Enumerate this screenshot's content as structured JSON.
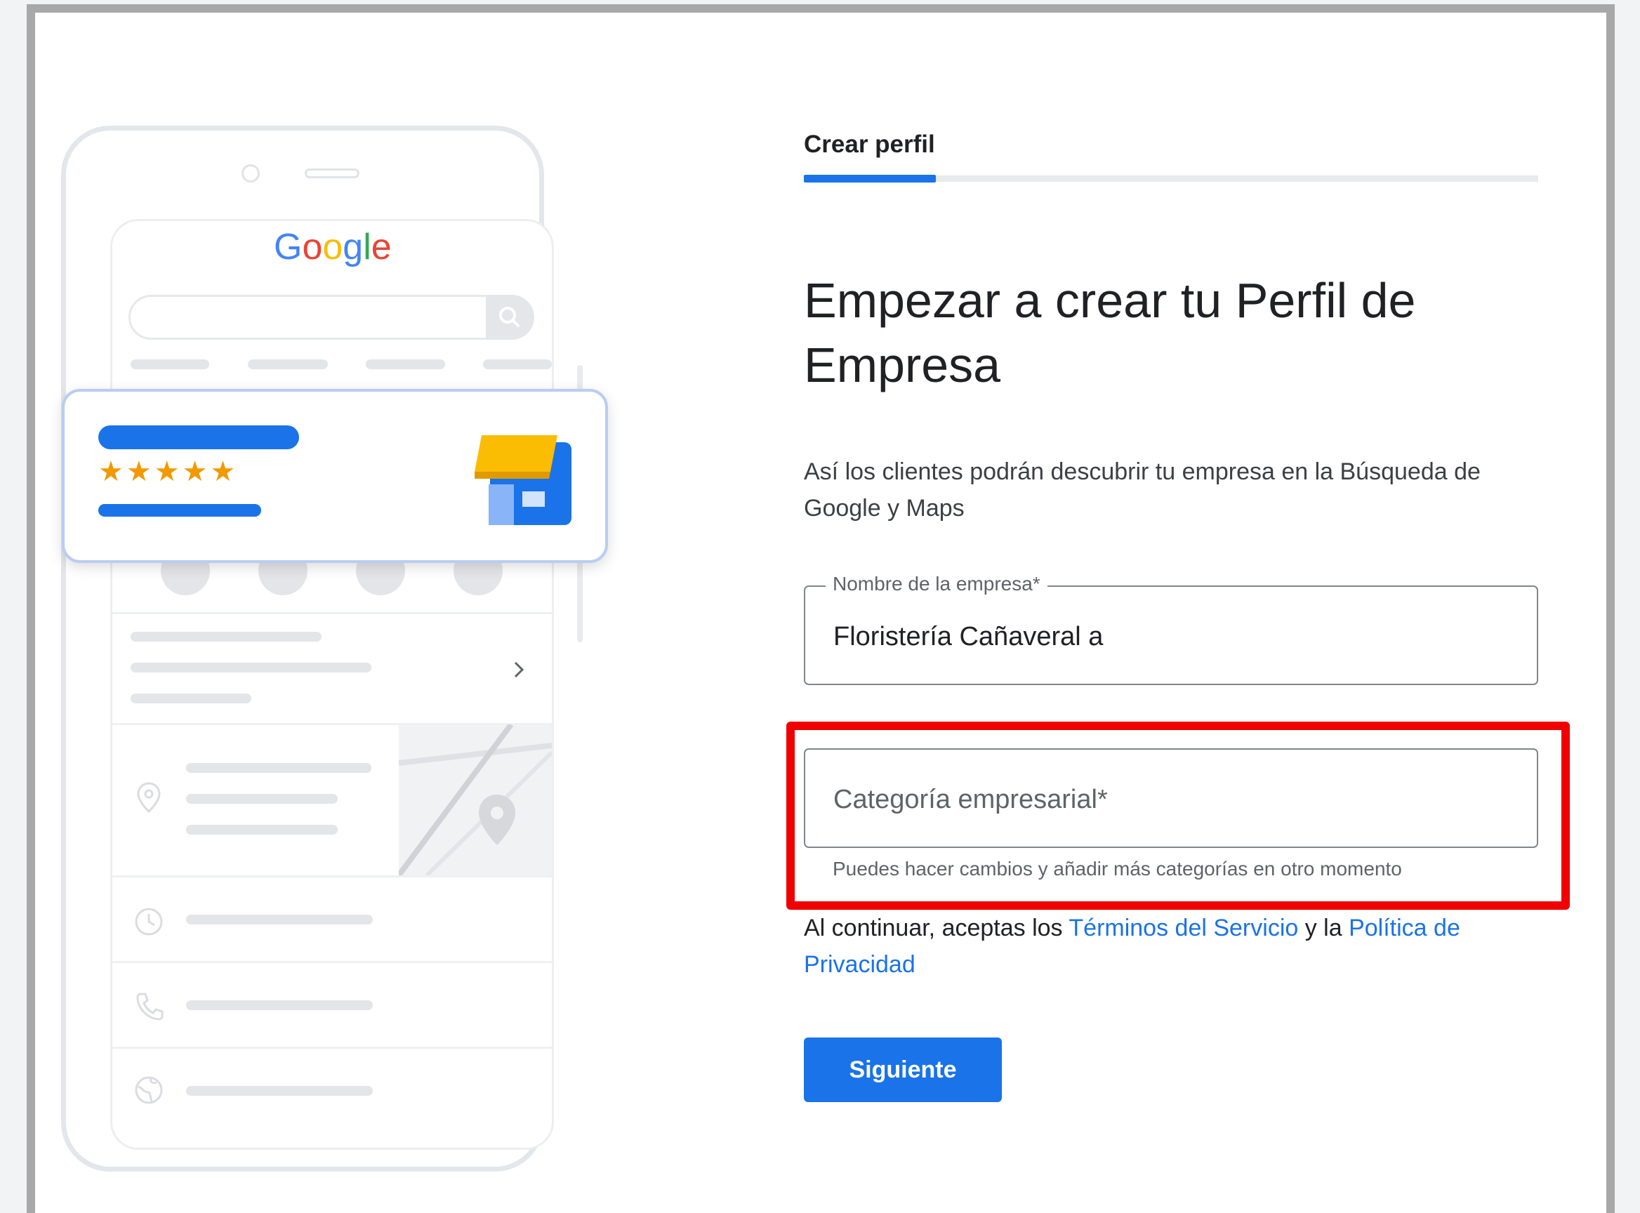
{
  "illustration": {
    "logo": {
      "G": "G",
      "o1": "o",
      "o2": "o",
      "g": "g",
      "l": "l",
      "e": "e"
    },
    "stars": "★★★★★",
    "colors": {
      "blue": "#1a73e8",
      "red": "#ea4335",
      "yellow": "#fbbc04",
      "green": "#34a853",
      "star": "#f29900"
    },
    "icons": [
      "search-icon",
      "phone-icon",
      "directions-icon",
      "bookmark-icon",
      "share-icon",
      "chevron-right-icon",
      "location-pin-icon",
      "clock-icon",
      "phone-icon",
      "globe-icon",
      "storefront-icon"
    ]
  },
  "form": {
    "step_label": "Crear perfil",
    "progress_fraction": 0.18,
    "title": "Empezar a crear tu Perfil de Empresa",
    "description": "Así los clientes podrán descubrir tu empresa en la Búsqueda de Google y Maps",
    "business_name": {
      "label": "Nombre de la empresa*",
      "value": "Floristería Cañaveral a"
    },
    "business_category": {
      "placeholder": "Categoría empresarial*",
      "helper": "Puedes hacer cambios y añadir más categorías en otro momento"
    },
    "consent": {
      "prefix": "Al continuar, aceptas los ",
      "terms_link": "Términos del Servicio",
      "middle": " y la ",
      "privacy_link": "Política de Privacidad"
    },
    "next_button": "Siguiente"
  },
  "highlight_color": "#f00000"
}
